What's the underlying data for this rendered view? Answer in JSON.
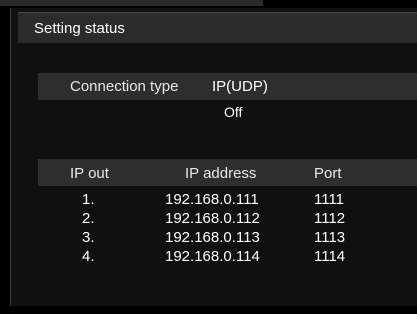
{
  "title": "Setting status",
  "connection": {
    "label": "Connection type",
    "value": "IP(UDP)",
    "status": "Off"
  },
  "table": {
    "headers": {
      "ip_out": "IP out",
      "ip_address": "IP address",
      "port": "Port"
    },
    "rows": [
      {
        "index": "1.",
        "address": "192.168.0.111",
        "port": "1111"
      },
      {
        "index": "2.",
        "address": "192.168.0.112",
        "port": "1112"
      },
      {
        "index": "3.",
        "address": "192.168.0.113",
        "port": "1113"
      },
      {
        "index": "4.",
        "address": "192.168.0.114",
        "port": "1114"
      }
    ]
  },
  "colors": {
    "background": "#000000",
    "panel": "#101010",
    "header_bar": "#2e2e2e",
    "text": "#ffffff"
  }
}
